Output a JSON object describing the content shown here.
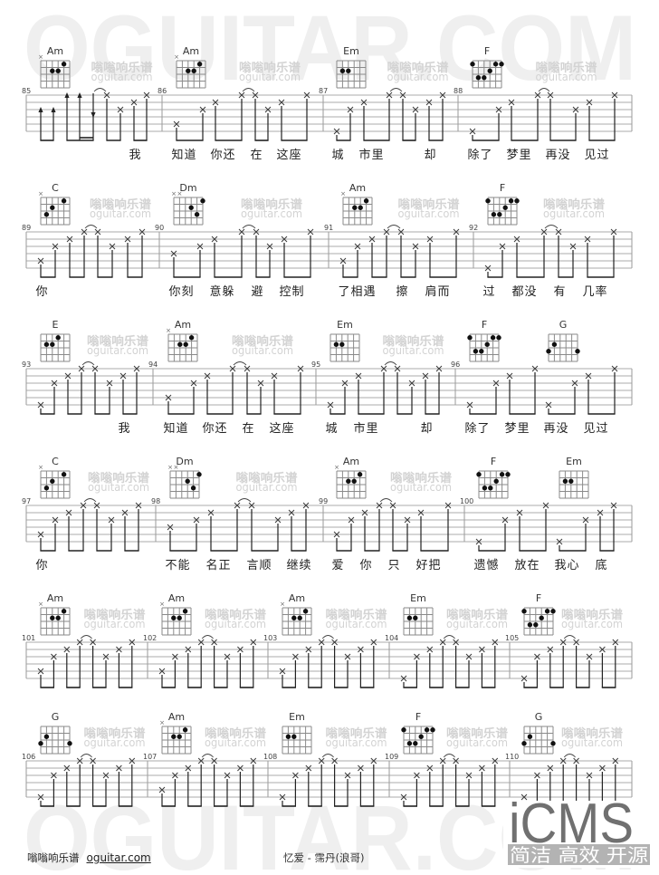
{
  "watermark": {
    "big": "OGUITAR.COM",
    "site_cn": "嗡嗡响乐谱",
    "site_en": "oguitar.com"
  },
  "chord_symbols": {
    "muted": "×"
  },
  "chords": {
    "Am": {
      "muted": [
        6
      ],
      "dots": [
        [
          2,
          1
        ],
        [
          4,
          2
        ],
        [
          3,
          2
        ]
      ]
    },
    "Em": {
      "muted": [],
      "dots": [
        [
          5,
          2
        ],
        [
          4,
          2
        ]
      ]
    },
    "F": {
      "muted": [],
      "dots": [
        [
          6,
          1
        ],
        [
          2,
          1
        ],
        [
          1,
          1
        ],
        [
          3,
          2
        ],
        [
          5,
          3
        ],
        [
          4,
          3
        ]
      ]
    },
    "C": {
      "muted": [
        6
      ],
      "dots": [
        [
          2,
          1
        ],
        [
          4,
          2
        ],
        [
          5,
          3
        ]
      ]
    },
    "Dm": {
      "muted": [
        6,
        5
      ],
      "dots": [
        [
          1,
          1
        ],
        [
          3,
          2
        ],
        [
          2,
          3
        ]
      ]
    },
    "E": {
      "muted": [],
      "dots": [
        [
          3,
          1
        ],
        [
          5,
          2
        ],
        [
          4,
          2
        ]
      ]
    },
    "G": {
      "muted": [],
      "dots": [
        [
          5,
          2
        ],
        [
          6,
          3
        ],
        [
          1,
          3
        ]
      ]
    }
  },
  "default_beams": [
    [
      0,
      1
    ],
    [
      2,
      3
    ],
    [
      4,
      5
    ],
    [
      6,
      7
    ]
  ],
  "systems": [
    {
      "measures": [
        {
          "number": 85,
          "chords": [
            {
              "name": "Am",
              "at": 0
            }
          ],
          "notes": [
            {
              "strum": "up",
              "from": 6,
              "to": 3
            },
            {
              "strum": "up",
              "from": 6,
              "to": 3
            },
            {
              "strum": "up",
              "from": 6,
              "to": 1
            },
            {
              "strum": "up",
              "from": 6,
              "to": 1
            },
            {
              "strum": "down",
              "from": 1,
              "to": 4
            },
            1,
            3,
            2,
            1
          ],
          "beams": [
            [
              0,
              1
            ],
            [
              2,
              4
            ],
            [
              5,
              6
            ],
            [
              7,
              8
            ]
          ],
          "sub_beams": [
            [
              3,
              4
            ]
          ],
          "ties": [
            [
              4,
              5
            ]
          ],
          "lyrics": [
            {
              "text": "我",
              "at": 7
            }
          ]
        },
        {
          "number": 86,
          "chords": [
            {
              "name": "Am",
              "at": 0
            }
          ],
          "notes": [
            5,
            3,
            2,
            1,
            1,
            3,
            2,
            1
          ],
          "ties": [
            [
              3,
              4
            ]
          ],
          "lyrics": [
            {
              "text": "知道",
              "at": 0
            },
            {
              "text": "你还",
              "at": 2
            },
            {
              "text": "在",
              "at": 4
            },
            {
              "text": "这座",
              "at": 6
            }
          ]
        },
        {
          "number": 87,
          "chords": [
            {
              "name": "Em",
              "at": 0
            }
          ],
          "notes": [
            6,
            3,
            2,
            1,
            1,
            3,
            2,
            1
          ],
          "ties": [
            [
              3,
              4
            ]
          ],
          "lyrics": [
            {
              "text": "城",
              "at": 0
            },
            {
              "text": "市里",
              "at": 2
            },
            {
              "text": "却",
              "at": 6
            }
          ]
        },
        {
          "number": 88,
          "chords": [
            {
              "name": "F",
              "at": 0
            }
          ],
          "notes": [
            6,
            3,
            2,
            1,
            1,
            3,
            2,
            1
          ],
          "ties": [
            [
              3,
              4
            ]
          ],
          "lyrics": [
            {
              "text": "除了",
              "at": 0
            },
            {
              "text": "梦里",
              "at": 2
            },
            {
              "text": "再没",
              "at": 4
            },
            {
              "text": "见过",
              "at": 6
            }
          ]
        }
      ]
    },
    {
      "measures": [
        {
          "number": 89,
          "chords": [
            {
              "name": "C",
              "at": 0
            }
          ],
          "notes": [
            5,
            3,
            2,
            1,
            1,
            3,
            2,
            1
          ],
          "ties": [
            [
              3,
              4
            ]
          ],
          "lyrics": [
            {
              "text": "你",
              "at": 0
            }
          ]
        },
        {
          "number": 90,
          "chords": [
            {
              "name": "Dm",
              "at": 0
            }
          ],
          "notes": [
            4,
            3,
            2,
            1,
            1,
            3,
            2,
            1
          ],
          "ties": [
            [
              3,
              4
            ]
          ],
          "lyrics": [
            {
              "text": "你刻",
              "at": 0
            },
            {
              "text": "意躲",
              "at": 2
            },
            {
              "text": "避",
              "at": 4
            },
            {
              "text": "控制",
              "at": 6
            }
          ]
        },
        {
          "number": 91,
          "chords": [
            {
              "name": "Am",
              "at": 0
            }
          ],
          "notes": [
            5,
            3,
            2,
            1,
            1,
            3,
            2,
            1
          ],
          "ties": [
            [
              3,
              4
            ]
          ],
          "lyrics": [
            {
              "text": "了相遇",
              "at": 0
            },
            {
              "text": "擦",
              "at": 4
            },
            {
              "text": "肩而",
              "at": 6
            }
          ]
        },
        {
          "number": 92,
          "chords": [
            {
              "name": "F",
              "at": 0
            }
          ],
          "notes": [
            6,
            3,
            2,
            1,
            1,
            3,
            2,
            1
          ],
          "ties": [
            [
              3,
              4
            ]
          ],
          "lyrics": [
            {
              "text": "过",
              "at": 0
            },
            {
              "text": "都没",
              "at": 2
            },
            {
              "text": "有",
              "at": 4
            },
            {
              "text": "几率",
              "at": 6
            }
          ]
        }
      ]
    },
    {
      "measures": [
        {
          "number": 93,
          "chords": [
            {
              "name": "E",
              "at": 0
            }
          ],
          "notes": [
            6,
            3,
            2,
            1,
            1,
            3,
            2,
            1
          ],
          "ties": [
            [
              3,
              4
            ]
          ],
          "lyrics": [
            {
              "text": "我",
              "at": 6
            }
          ]
        },
        {
          "number": 94,
          "chords": [
            {
              "name": "Am",
              "at": 0
            }
          ],
          "notes": [
            5,
            3,
            2,
            1,
            1,
            3,
            2,
            1
          ],
          "ties": [
            [
              3,
              4
            ]
          ],
          "lyrics": [
            {
              "text": "知道",
              "at": 0
            },
            {
              "text": "你还",
              "at": 2
            },
            {
              "text": "在",
              "at": 4
            },
            {
              "text": "这座",
              "at": 6
            }
          ]
        },
        {
          "number": 95,
          "chords": [
            {
              "name": "Em",
              "at": 0
            }
          ],
          "notes": [
            6,
            3,
            2,
            1,
            1,
            3,
            2,
            1
          ],
          "ties": [
            [
              3,
              4
            ]
          ],
          "lyrics": [
            {
              "text": "城",
              "at": 0
            },
            {
              "text": "市里",
              "at": 2
            },
            {
              "text": "却",
              "at": 6
            }
          ]
        },
        {
          "number": 96,
          "chords": [
            {
              "name": "F",
              "at": 0
            },
            {
              "name": "G",
              "at": 4
            }
          ],
          "notes": [
            6,
            3,
            2,
            1,
            6,
            3,
            2,
            1
          ],
          "ties": [],
          "lyrics": [
            {
              "text": "除了",
              "at": 0
            },
            {
              "text": "梦里",
              "at": 2
            },
            {
              "text": "再没",
              "at": 4
            },
            {
              "text": "见过",
              "at": 6
            }
          ]
        }
      ]
    },
    {
      "measures": [
        {
          "number": 97,
          "chords": [
            {
              "name": "C",
              "at": 0
            }
          ],
          "notes": [
            5,
            3,
            2,
            1,
            1,
            3,
            2,
            1
          ],
          "ties": [
            [
              3,
              4
            ]
          ],
          "lyrics": [
            {
              "text": "你",
              "at": 0
            }
          ]
        },
        {
          "number": 98,
          "chords": [
            {
              "name": "Dm",
              "at": 0
            }
          ],
          "notes": [
            4,
            3,
            2,
            1,
            1,
            3,
            2,
            1
          ],
          "ties": [
            [
              3,
              4
            ]
          ],
          "lyrics": [
            {
              "text": "不能",
              "at": 0
            },
            {
              "text": "名正",
              "at": 2
            },
            {
              "text": "言顺",
              "at": 4
            },
            {
              "text": "继续",
              "at": 6
            }
          ]
        },
        {
          "number": 99,
          "chords": [
            {
              "name": "Am",
              "at": 0
            }
          ],
          "notes": [
            5,
            3,
            2,
            1,
            1,
            3,
            2,
            1
          ],
          "ties": [
            [
              3,
              4
            ]
          ],
          "lyrics": [
            {
              "text": "爱",
              "at": 0
            },
            {
              "text": "你",
              "at": 2
            },
            {
              "text": "只",
              "at": 4
            },
            {
              "text": "好把",
              "at": 6
            }
          ]
        },
        {
          "number": 100,
          "chords": [
            {
              "name": "F",
              "at": 0
            },
            {
              "name": "Em",
              "at": 4
            }
          ],
          "notes": [
            6,
            3,
            2,
            1,
            6,
            3,
            2,
            1
          ],
          "ties": [],
          "lyrics": [
            {
              "text": "遗憾",
              "at": 0
            },
            {
              "text": "放在",
              "at": 2
            },
            {
              "text": "我心",
              "at": 4
            },
            {
              "text": "底",
              "at": 6
            }
          ]
        }
      ]
    },
    {
      "measures": [
        {
          "number": 101,
          "chords": [
            {
              "name": "Am",
              "at": 0
            }
          ],
          "notes": [
            5,
            3,
            2,
            1,
            1,
            3,
            2,
            1
          ],
          "ties": [
            [
              3,
              4
            ]
          ],
          "lyrics": []
        },
        {
          "number": 102,
          "chords": [
            {
              "name": "Am",
              "at": 0
            }
          ],
          "notes": [
            5,
            3,
            2,
            1,
            1,
            3,
            2,
            1
          ],
          "ties": [
            [
              3,
              4
            ]
          ],
          "lyrics": []
        },
        {
          "number": 103,
          "chords": [
            {
              "name": "Am",
              "at": 0
            }
          ],
          "notes": [
            5,
            3,
            2,
            1,
            1,
            3,
            2,
            1
          ],
          "ties": [
            [
              3,
              4
            ]
          ],
          "lyrics": []
        },
        {
          "number": 104,
          "chords": [
            {
              "name": "Em",
              "at": 0
            }
          ],
          "notes": [
            6,
            3,
            2,
            1,
            1,
            3,
            2,
            1
          ],
          "ties": [
            [
              3,
              4
            ]
          ],
          "lyrics": []
        },
        {
          "number": 105,
          "chords": [
            {
              "name": "F",
              "at": 0
            }
          ],
          "notes": [
            6,
            3,
            2,
            1,
            1,
            3,
            2,
            1
          ],
          "ties": [
            [
              3,
              4
            ]
          ],
          "lyrics": []
        }
      ]
    },
    {
      "measures": [
        {
          "number": 106,
          "chords": [
            {
              "name": "G",
              "at": 0
            }
          ],
          "notes": [
            6,
            3,
            2,
            1,
            1,
            3,
            2,
            1
          ],
          "ties": [
            [
              3,
              4
            ]
          ],
          "lyrics": []
        },
        {
          "number": 107,
          "chords": [
            {
              "name": "Am",
              "at": 0
            }
          ],
          "notes": [
            5,
            3,
            2,
            1,
            1,
            3,
            2,
            1
          ],
          "ties": [
            [
              3,
              4
            ]
          ],
          "lyrics": []
        },
        {
          "number": 108,
          "chords": [
            {
              "name": "Em",
              "at": 0
            }
          ],
          "notes": [
            6,
            3,
            2,
            1,
            1,
            3,
            2,
            1
          ],
          "ties": [
            [
              3,
              4
            ]
          ],
          "lyrics": []
        },
        {
          "number": 109,
          "chords": [
            {
              "name": "F",
              "at": 0
            }
          ],
          "notes": [
            6,
            3,
            2,
            1,
            1,
            3,
            2,
            1
          ],
          "ties": [
            [
              3,
              4
            ]
          ],
          "lyrics": []
        },
        {
          "number": 110,
          "chords": [
            {
              "name": "G",
              "at": 0
            }
          ],
          "notes": [
            6,
            3,
            2,
            1,
            1,
            3,
            2,
            1
          ],
          "ties": [
            [
              3,
              4
            ]
          ],
          "lyrics": []
        }
      ]
    }
  ],
  "footer": {
    "site_cn": "嗡嗡响乐谱",
    "link": "oguitar.com",
    "song_title": "忆爱 - 霈丹(浪哥)"
  },
  "icms": {
    "logo": "iCMS",
    "slogan": "简洁 高效 开源"
  }
}
